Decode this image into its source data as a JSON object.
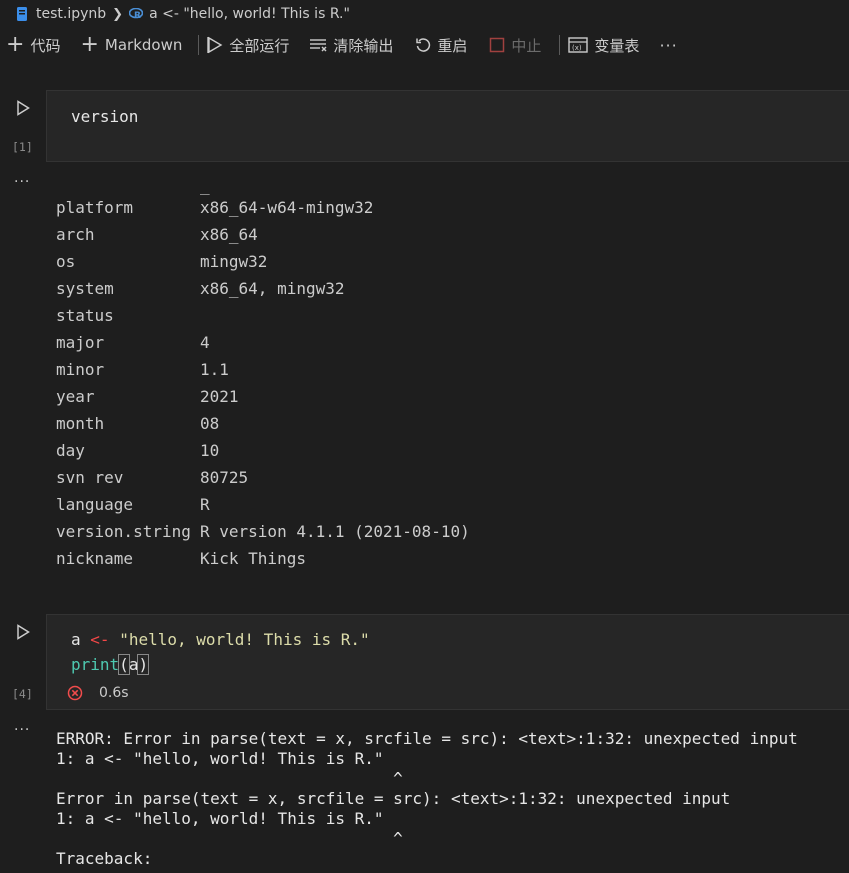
{
  "breadcrumb": {
    "file": "test.ipynb",
    "cell": "a <- \"hello, world! This is R.\""
  },
  "toolbar": {
    "code": "代码",
    "markdown": "Markdown",
    "run_all": "全部运行",
    "clear_outputs": "清除输出",
    "restart": "重启",
    "interrupt": "中止",
    "variables": "变量表",
    "more": "···"
  },
  "cell1": {
    "exec_count": "[1]",
    "code": "version",
    "more": "···",
    "output_header": "_",
    "rows": [
      {
        "key": "platform",
        "value": "x86_64-w64-mingw32"
      },
      {
        "key": "arch",
        "value": "x86_64"
      },
      {
        "key": "os",
        "value": "mingw32"
      },
      {
        "key": "system",
        "value": "x86_64, mingw32"
      },
      {
        "key": "status",
        "value": ""
      },
      {
        "key": "major",
        "value": "4"
      },
      {
        "key": "minor",
        "value": "1.1"
      },
      {
        "key": "year",
        "value": "2021"
      },
      {
        "key": "month",
        "value": "08"
      },
      {
        "key": "day",
        "value": "10"
      },
      {
        "key": "svn rev",
        "value": "80725"
      },
      {
        "key": "language",
        "value": "R"
      },
      {
        "key": "version.string",
        "value": "R version 4.1.1 (2021-08-10)"
      },
      {
        "key": "nickname",
        "value": "Kick Things"
      }
    ]
  },
  "cell2": {
    "exec_count": "[4]",
    "line1": {
      "var": "a",
      "op": "<-",
      "str": "\"hello, world! This is R.\""
    },
    "line2": {
      "fn": "print",
      "open": "(",
      "arg": "a",
      "close": ")"
    },
    "status_time": "0.6s",
    "more": "···",
    "error_lines": [
      "ERROR: Error in parse(text = x, srcfile = src): <text>:1:32: unexpected input",
      "1: a <- \"hello, world! This is R.\"",
      "                                   ^",
      "Error in parse(text = x, srcfile = src): <text>:1:32: unexpected input",
      "1: a <- \"hello, world! This is R.\"",
      "                                   ^",
      "Traceback:"
    ]
  },
  "colors": {
    "background": "#1e1e1e",
    "editor_bg": "#262626",
    "string": "#dcdcaa",
    "operator": "#f44747",
    "function": "#4ec9b0",
    "error_icon": "#f14c4c"
  }
}
